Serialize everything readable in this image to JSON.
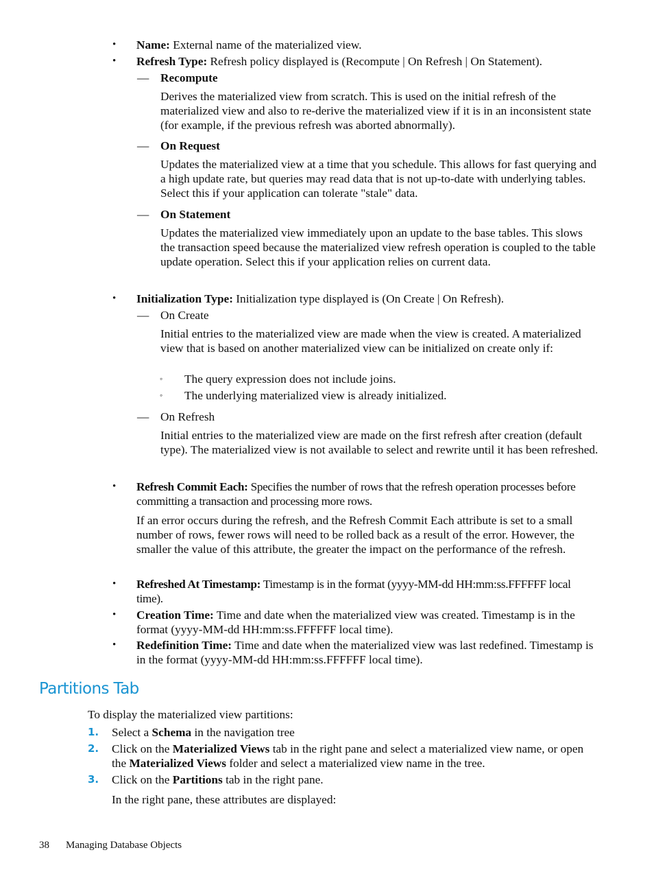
{
  "attributes": [
    {
      "term": "Name:",
      "desc": " External name of the materialized view."
    },
    {
      "term": "Refresh Type:",
      "desc": " Refresh policy displayed is (Recompute | On Refresh | On Statement)."
    },
    {
      "term": "Initialization Type:",
      "desc": " Initialization type displayed is (On Create | On Refresh)."
    },
    {
      "term": "Refresh Commit Each:",
      "desc": " Specifies the number of rows that the refresh operation processes before committing a transaction and processing more rows."
    },
    {
      "term": "Refreshed At Timestamp:",
      "desc": " Timestamp is in the format (yyyy-MM-dd HH:mm:ss.FFFFFF local time)."
    },
    {
      "term": "Creation Time:",
      "desc": " Time and date when the materialized view was created. Timestamp is in the format (yyyy-MM-dd HH:mm:ss.FFFFFF local time)."
    },
    {
      "term": "Redefinition Time:",
      "desc": " Time and date when the materialized view was last redefined. Timestamp is in the format (yyyy-MM-dd HH:mm:ss.FFFFFF local time)."
    }
  ],
  "refresh_types": [
    {
      "label": "Recompute",
      "desc": "Derives the materialized view from scratch. This is used on the initial refresh of the materialized view and also to re-derive the materialized view if it is in an inconsistent state (for example, if the previous refresh was aborted abnormally)."
    },
    {
      "label": "On Request",
      "desc": "Updates the materialized view at a time that you schedule. This allows for fast querying and a high update rate, but queries may read data that is not up-to-date with underlying tables. Select this if your application can tolerate \"stale\" data."
    },
    {
      "label": "On Statement",
      "desc": "Updates the materialized view immediately upon an update to the base tables. This slows the transaction speed because the materialized view refresh operation is coupled to the table update operation. Select this if your application relies on current data."
    }
  ],
  "init_types": [
    {
      "label": "On Create",
      "desc": "Initial entries to the materialized view are made when the view is created. A materialized view that is based on another materialized view can be initialized on create only if:",
      "conditions": [
        "The query expression does not include joins.",
        "The underlying materialized view is already initialized."
      ]
    },
    {
      "label": "On Refresh",
      "desc": "Initial entries to the materialized view are made on the first refresh after creation (default type). The materialized view is not available to select and rewrite until it has been refreshed."
    }
  ],
  "refresh_commit_note": "If an error occurs during the refresh, and the Refresh Commit Each attribute is set to a small number of rows, fewer rows will need to be rolled back as a result of the error. However, the smaller the value of this attribute, the greater the impact on the performance of the refresh.",
  "section": {
    "title": "Partitions Tab",
    "intro": "To display the materialized view partitions:",
    "steps": [
      {
        "num": "1.",
        "parts": [
          "Select a ",
          "Schema",
          " in the navigation tree"
        ]
      },
      {
        "num": "2.",
        "parts": [
          "Click on the ",
          "Materialized Views",
          " tab in the right pane and select a materialized view name, or open the ",
          "Materialized Views",
          " folder and select a materialized view name in the tree."
        ]
      },
      {
        "num": "3.",
        "parts": [
          "Click on the ",
          "Partitions",
          " tab in the right pane."
        ]
      }
    ],
    "note": "In the right pane, these attributes are displayed:"
  },
  "footer": {
    "page_number": "38",
    "chapter": "Managing Database Objects"
  },
  "symbols": {
    "bullet": "•",
    "dash": "—",
    "circle": "◦"
  }
}
